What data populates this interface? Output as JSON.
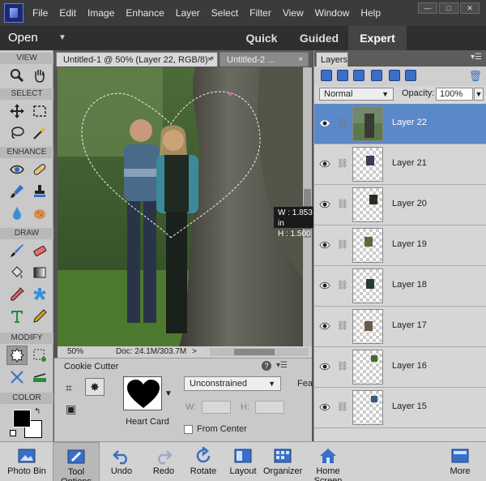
{
  "menu": [
    "File",
    "Edit",
    "Image",
    "Enhance",
    "Layer",
    "Select",
    "Filter",
    "View",
    "Window",
    "Help"
  ],
  "window_controls": {
    "minimize": "—",
    "maximize": "□",
    "close": "✕"
  },
  "modes": {
    "open": "Open",
    "quick": "Quick",
    "guided": "Guided",
    "expert": "Expert",
    "active": "Expert"
  },
  "toolbox": {
    "sections": {
      "view": "VIEW",
      "select": "SELECT",
      "enhance": "ENHANCE",
      "draw": "DRAW",
      "modify": "MODIFY",
      "color": "COLOR"
    },
    "tools": [
      {
        "section": "view",
        "icon": "zoom-icon"
      },
      {
        "section": "view",
        "icon": "hand-icon"
      },
      {
        "section": "select",
        "icon": "move-icon"
      },
      {
        "section": "select",
        "icon": "marquee-icon"
      },
      {
        "section": "select",
        "icon": "lasso-icon"
      },
      {
        "section": "select",
        "icon": "magic-wand-icon"
      },
      {
        "section": "enhance",
        "icon": "red-eye-icon"
      },
      {
        "section": "enhance",
        "icon": "healing-brush-icon"
      },
      {
        "section": "enhance",
        "icon": "smart-brush-icon"
      },
      {
        "section": "enhance",
        "icon": "clone-stamp-icon"
      },
      {
        "section": "enhance",
        "icon": "blur-icon"
      },
      {
        "section": "enhance",
        "icon": "sponge-icon"
      },
      {
        "section": "draw",
        "icon": "brush-icon"
      },
      {
        "section": "draw",
        "icon": "eraser-icon"
      },
      {
        "section": "draw",
        "icon": "paint-bucket-icon"
      },
      {
        "section": "draw",
        "icon": "gradient-icon"
      },
      {
        "section": "draw",
        "icon": "eyedropper-icon"
      },
      {
        "section": "draw",
        "icon": "custom-shape-icon"
      },
      {
        "section": "draw",
        "icon": "type-icon"
      },
      {
        "section": "draw",
        "icon": "pencil-icon"
      },
      {
        "section": "modify",
        "icon": "cookie-cutter-icon",
        "active": true
      },
      {
        "section": "modify",
        "icon": "recompose-icon"
      },
      {
        "section": "modify",
        "icon": "content-aware-move-icon"
      },
      {
        "section": "modify",
        "icon": "straighten-icon"
      }
    ],
    "foreground_color": "#000000",
    "background_color": "#ffffff"
  },
  "document_tabs": [
    {
      "label": "Untitled-1 @ 50% (Layer 22, RGB/8) *",
      "close": "×",
      "active": true
    },
    {
      "label": "Untitled-2 ...",
      "close": "×",
      "active": false
    }
  ],
  "status": {
    "zoom": "50%",
    "doc": "Doc: 24.1M/303.7M",
    "arrow": ">"
  },
  "tooltip": {
    "w": "W : 1.853 in",
    "h": "H : 1.500 in"
  },
  "tool_options": {
    "title": "Cookie Cutter",
    "help": "?",
    "shape_label": "Heart Card",
    "constraint": "Unconstrained",
    "w_label": "W:",
    "h_label": "H:",
    "from_center": "From Center",
    "feather": "Fea"
  },
  "layers_panel": {
    "tab": "Layers",
    "blend_mode": "Normal",
    "opacity_label": "Opacity:",
    "opacity": "100%",
    "layers": [
      {
        "name": "Layer 22",
        "selected": true
      },
      {
        "name": "Layer 21",
        "selected": false
      },
      {
        "name": "Layer 20",
        "selected": false
      },
      {
        "name": "Layer 19",
        "selected": false
      },
      {
        "name": "Layer 18",
        "selected": false
      },
      {
        "name": "Layer 17",
        "selected": false
      },
      {
        "name": "Layer 16",
        "selected": false
      },
      {
        "name": "Layer 15",
        "selected": false
      }
    ]
  },
  "bottom_bar": [
    {
      "label": "Photo Bin",
      "icon": "photo-bin-icon"
    },
    {
      "label": "Tool Options",
      "icon": "tool-options-icon",
      "active": true
    },
    {
      "label": "Undo",
      "icon": "undo-icon"
    },
    {
      "label": "Redo",
      "icon": "redo-icon"
    },
    {
      "label": "Rotate",
      "icon": "rotate-icon"
    },
    {
      "label": "Layout",
      "icon": "layout-icon"
    },
    {
      "label": "Organizer",
      "icon": "organizer-icon"
    },
    {
      "label": "Home Screen",
      "icon": "home-icon"
    },
    {
      "label": "More",
      "icon": "more-icon"
    }
  ],
  "colors": {
    "accent": "#5b88c8",
    "titlebar": "#3b3b3b",
    "panel": "#d6d6d6"
  }
}
